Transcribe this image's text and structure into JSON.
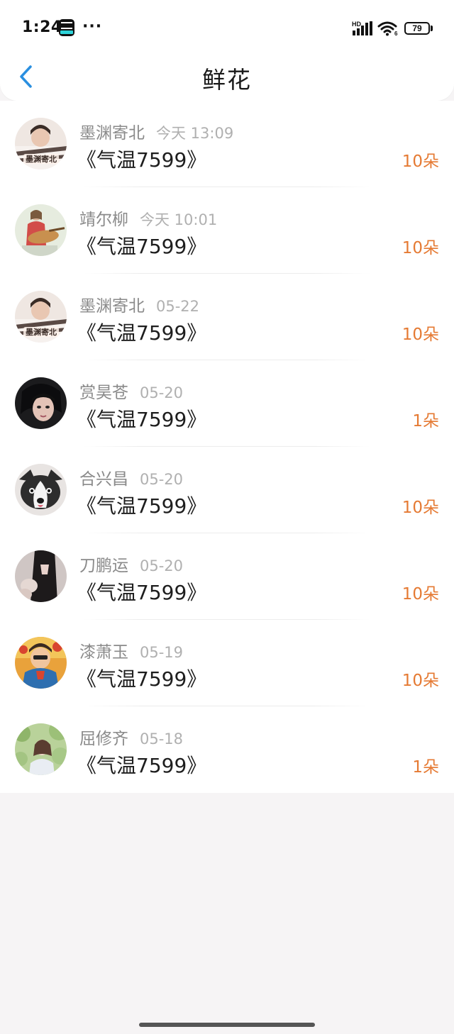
{
  "status_bar": {
    "time": "1:24",
    "more": "···",
    "network_label": "HD",
    "battery_level": "79",
    "wifi_badge": "6"
  },
  "header": {
    "title": "鲜花",
    "back_icon": "chevron-left-icon",
    "back_color": "#2a8fe0"
  },
  "colors": {
    "amount": "#e57a33",
    "username": "#8a8a8a",
    "date": "#b0b0b0"
  },
  "records": [
    {
      "user": "墨渊寄北",
      "time": "今天 13:09",
      "book": "《气温7599》",
      "amount": "10朵"
    },
    {
      "user": "靖尔柳",
      "time": "今天 10:01",
      "book": "《气温7599》",
      "amount": "10朵"
    },
    {
      "user": "墨渊寄北",
      "time": "05-22",
      "book": "《气温7599》",
      "amount": "10朵"
    },
    {
      "user": "赏昊苍",
      "time": "05-20",
      "book": "《气温7599》",
      "amount": "1朵"
    },
    {
      "user": "合兴昌",
      "time": "05-20",
      "book": "《气温7599》",
      "amount": "10朵"
    },
    {
      "user": "刀鹏运",
      "time": "05-20",
      "book": "《气温7599》",
      "amount": "10朵"
    },
    {
      "user": "漆萧玉",
      "time": "05-19",
      "book": "《气温7599》",
      "amount": "10朵"
    },
    {
      "user": "屈修齐",
      "time": "05-18",
      "book": "《气温7599》",
      "amount": "1朵"
    }
  ]
}
